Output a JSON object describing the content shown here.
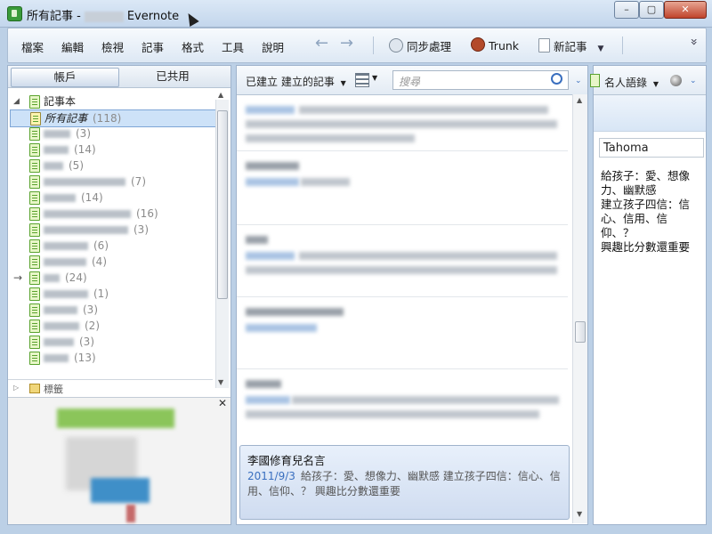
{
  "window": {
    "title_prefix": "所有記事 -",
    "title_suffix": "Evernote",
    "controls": {
      "minimize": "–",
      "maximize": "▢",
      "close": "✕"
    }
  },
  "menu": [
    "檔案",
    "編輯",
    "檢視",
    "記事",
    "格式",
    "工具",
    "說明"
  ],
  "toolbar": {
    "back": "←",
    "forward": "→",
    "sync": "同步處理",
    "trunk": "Trunk",
    "new_note": "新記事",
    "overflow": "»"
  },
  "left_panel": {
    "tabs": [
      "帳戶",
      "已共用"
    ],
    "notebooks_header": "記事本",
    "all_notes": {
      "label": "所有記事",
      "count": "(118)"
    },
    "notebooks": [
      {
        "count": "(3)"
      },
      {
        "count": "(14)"
      },
      {
        "count": "(5)"
      },
      {
        "count": "(7)"
      },
      {
        "count": "(14)"
      },
      {
        "count": "(16)"
      },
      {
        "count": "(3)"
      },
      {
        "count": "(6)"
      },
      {
        "count": "(4)"
      },
      {
        "count": "(24)"
      },
      {
        "count": "(1)"
      },
      {
        "count": "(3)"
      },
      {
        "count": "(2)"
      },
      {
        "count": "(3)"
      },
      {
        "count": "(13)"
      }
    ],
    "tags_header": "標籤",
    "close_preview": "✕"
  },
  "middle_panel": {
    "sort_label": "已建立 建立的記事",
    "search_placeholder": "搜尋",
    "selected_note": {
      "title": "李國修育兒名言",
      "date": "2011/9/3",
      "snippet": "給孩子：愛、想像力、幽默感 建立孩子四信：信心、信用、信仰、？ 興趣比分數還重要"
    }
  },
  "right_panel": {
    "notebook_select": "名人語錄",
    "font": "Tahoma",
    "content": [
      "給孩子：愛、想像力、幽默感",
      "建立孩子四信：信心、信用、信仰、？",
      "興趣比分數還重要"
    ]
  },
  "colors": {
    "accent": "#3a9b3a",
    "link": "#3a6fbf",
    "chrome": "#c3d6ec"
  }
}
